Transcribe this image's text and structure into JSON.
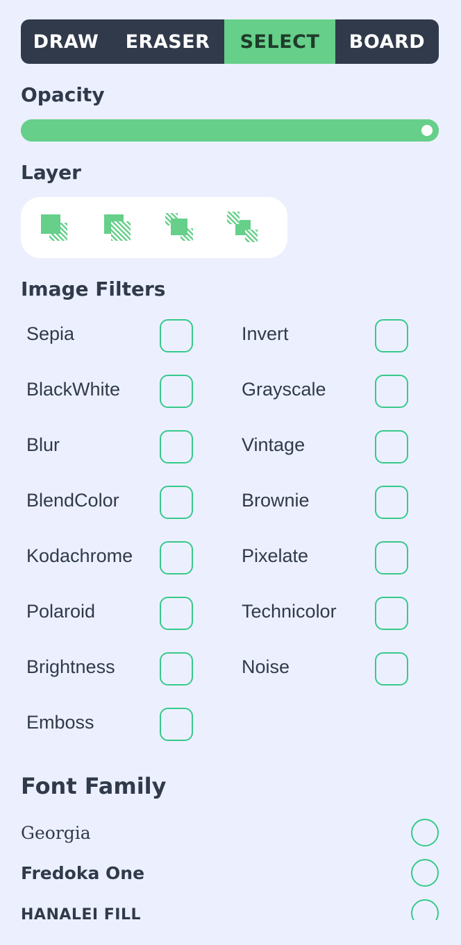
{
  "toolbar": {
    "tabs": [
      {
        "label": "DRAW",
        "active": false
      },
      {
        "label": "ERASER",
        "active": false
      },
      {
        "label": "SELECT",
        "active": true
      },
      {
        "label": "BOARD",
        "active": false
      }
    ]
  },
  "opacity": {
    "title": "Opacity",
    "value": 1.0
  },
  "layer": {
    "title": "Layer",
    "actions": [
      "bring-to-front-icon",
      "send-to-back-icon",
      "bring-forward-icon",
      "send-backward-icon"
    ]
  },
  "image_filters": {
    "title": "Image Filters",
    "items": [
      {
        "label": "Sepia",
        "checked": false
      },
      {
        "label": "Invert",
        "checked": false
      },
      {
        "label": "BlackWhite",
        "checked": false
      },
      {
        "label": "Grayscale",
        "checked": false
      },
      {
        "label": "Blur",
        "checked": false
      },
      {
        "label": "Vintage",
        "checked": false
      },
      {
        "label": "BlendColor",
        "checked": false
      },
      {
        "label": "Brownie",
        "checked": false
      },
      {
        "label": "Kodachrome",
        "checked": false
      },
      {
        "label": "Pixelate",
        "checked": false
      },
      {
        "label": "Polaroid",
        "checked": false
      },
      {
        "label": "Technicolor",
        "checked": false
      },
      {
        "label": "Brightness",
        "checked": false
      },
      {
        "label": "Noise",
        "checked": false
      },
      {
        "label": "Emboss",
        "checked": false
      }
    ]
  },
  "font_family": {
    "title": "Font Family",
    "items": [
      {
        "label": "Georgia",
        "selected": false
      },
      {
        "label": "Fredoka One",
        "selected": false
      },
      {
        "label": "HANALEI FILL",
        "selected": false
      }
    ]
  },
  "colors": {
    "background": "#ecf0fe",
    "dark": "#303a4b",
    "accent": "#66cf8a",
    "check_border": "#36c98a"
  }
}
